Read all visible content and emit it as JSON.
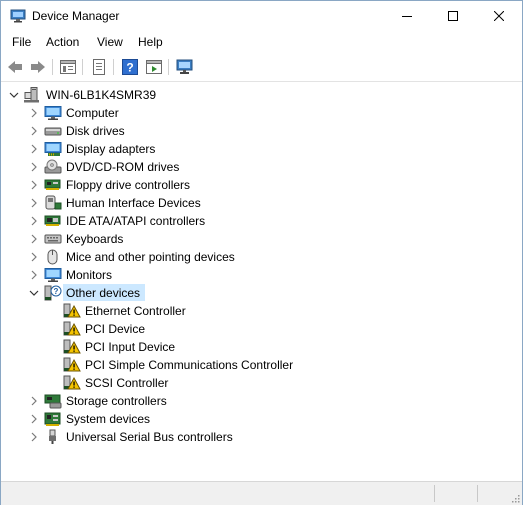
{
  "window": {
    "title": "Device Manager",
    "controls": [
      "minimize",
      "maximize",
      "close"
    ]
  },
  "menu": {
    "file": "File",
    "action": "Action",
    "view": "View",
    "help": "Help"
  },
  "toolbar": {
    "buttons": [
      "back-icon",
      "forward-icon",
      "properties-pane-icon",
      "properties-icon",
      "help-icon",
      "run-icon",
      "scan-hardware-icon"
    ]
  },
  "tree": {
    "root": "WIN-6LB1K4SMR39",
    "categories": [
      {
        "label": "Computer",
        "icon": "computer-icon",
        "expanded": false
      },
      {
        "label": "Disk drives",
        "icon": "disk-drive-icon",
        "expanded": false
      },
      {
        "label": "Display adapters",
        "icon": "display-adapter-icon",
        "expanded": false
      },
      {
        "label": "DVD/CD-ROM drives",
        "icon": "dvd-drive-icon",
        "expanded": false
      },
      {
        "label": "Floppy drive controllers",
        "icon": "floppy-controller-icon",
        "expanded": false
      },
      {
        "label": "Human Interface Devices",
        "icon": "hid-icon",
        "expanded": false
      },
      {
        "label": "IDE ATA/ATAPI controllers",
        "icon": "ide-controller-icon",
        "expanded": false
      },
      {
        "label": "Keyboards",
        "icon": "keyboard-icon",
        "expanded": false
      },
      {
        "label": "Mice and other pointing devices",
        "icon": "mouse-icon",
        "expanded": false
      },
      {
        "label": "Monitors",
        "icon": "monitor-icon",
        "expanded": false
      },
      {
        "label": "Other devices",
        "icon": "unknown-device-icon",
        "expanded": true,
        "selected": true
      },
      {
        "label": "Storage controllers",
        "icon": "storage-controller-icon",
        "expanded": false
      },
      {
        "label": "System devices",
        "icon": "system-devices-icon",
        "expanded": false
      },
      {
        "label": "Universal Serial Bus controllers",
        "icon": "usb-icon",
        "expanded": false
      }
    ],
    "other_devices": [
      {
        "label": "Ethernet Controller",
        "icon": "warning-device-icon"
      },
      {
        "label": "PCI Device",
        "icon": "warning-device-icon"
      },
      {
        "label": "PCI Input Device",
        "icon": "warning-device-icon"
      },
      {
        "label": "PCI Simple Communications Controller",
        "icon": "warning-device-icon"
      },
      {
        "label": "SCSI Controller",
        "icon": "warning-device-icon"
      }
    ]
  },
  "colors": {
    "selection": "#cce8ff",
    "warning": "#f5c400",
    "window_border": "#8aa7c4"
  }
}
